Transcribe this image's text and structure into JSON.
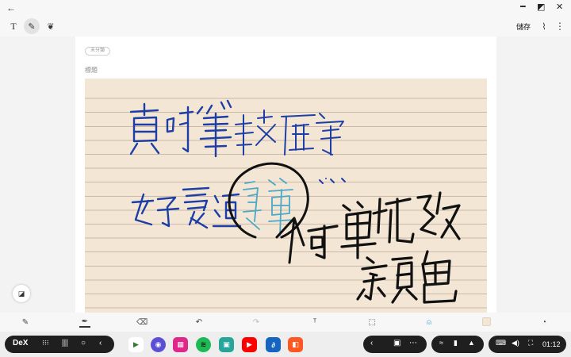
{
  "toolbar": {
    "save_label": "儲存"
  },
  "note": {
    "tag_label": "未分類",
    "title_placeholder": "標題"
  },
  "taskbar": {
    "dex_label": "DeX",
    "time": "01:12"
  },
  "icons": {
    "back": "back-arrow-icon",
    "text_mode": "text-mode-icon",
    "pen_mode": "pen-mode-icon",
    "brush_mode": "brush-mode-icon",
    "attach": "paperclip-icon",
    "more": "more-vert-icon"
  },
  "colors": {
    "paper": "#f4e6d4",
    "paper_lines": "#c9b9a6",
    "ink_blue": "#1d3fa5",
    "ink_lightblue": "#4aa8c8",
    "ink_black": "#111111",
    "taskbar_pill": "#1f1f1f"
  }
}
